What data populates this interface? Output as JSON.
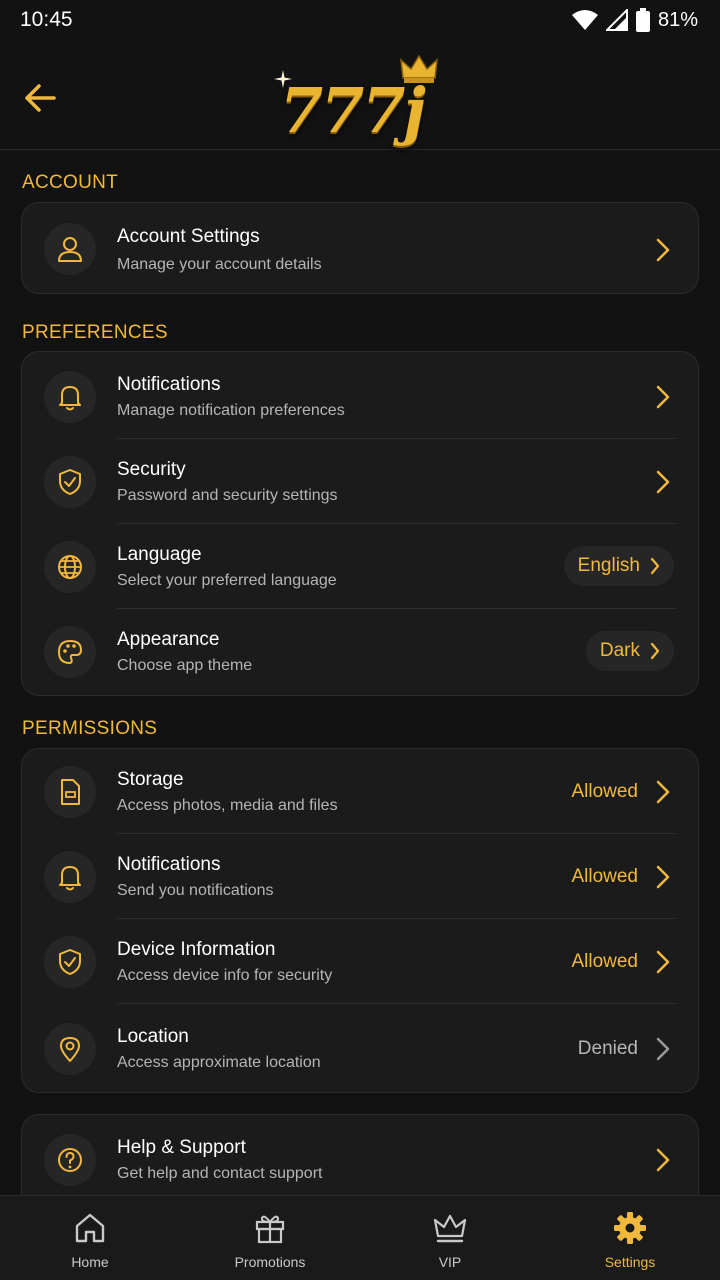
{
  "status_bar": {
    "time": "10:45",
    "battery": "81%"
  },
  "header": {
    "logo_text": "777j"
  },
  "sections": {
    "account": "ACCOUNT",
    "preferences": "PREFERENCES",
    "permissions": "PERMISSIONS"
  },
  "account": {
    "title": "Account Settings",
    "subtitle": "Manage your account details"
  },
  "preferences": [
    {
      "title": "Notifications",
      "subtitle": "Manage notification preferences"
    },
    {
      "title": "Security",
      "subtitle": "Password and security settings"
    },
    {
      "title": "Language",
      "subtitle": "Select your preferred language",
      "value": "English"
    },
    {
      "title": "Appearance",
      "subtitle": "Choose app theme",
      "value": "Dark"
    }
  ],
  "permissions": [
    {
      "title": "Storage",
      "subtitle": "Access photos, media and files",
      "value": "Allowed"
    },
    {
      "title": "Notifications",
      "subtitle": "Send you notifications",
      "value": "Allowed"
    },
    {
      "title": "Device Information",
      "subtitle": "Access device info for security",
      "value": "Allowed"
    },
    {
      "title": "Location",
      "subtitle": "Access approximate location",
      "value": "Denied"
    }
  ],
  "help": {
    "title": "Help & Support",
    "subtitle": "Get help and contact support"
  },
  "bottom_nav": [
    {
      "label": "Home",
      "icon": "home-icon"
    },
    {
      "label": "Promotions",
      "icon": "gift-icon"
    },
    {
      "label": "VIP",
      "icon": "crown-icon"
    },
    {
      "label": "Settings",
      "icon": "gear-icon",
      "active": true
    }
  ],
  "colors": {
    "accent": "#f0b83c",
    "background": "#121212",
    "card": "#1b1b1b",
    "denied": "#b5b5b5"
  }
}
